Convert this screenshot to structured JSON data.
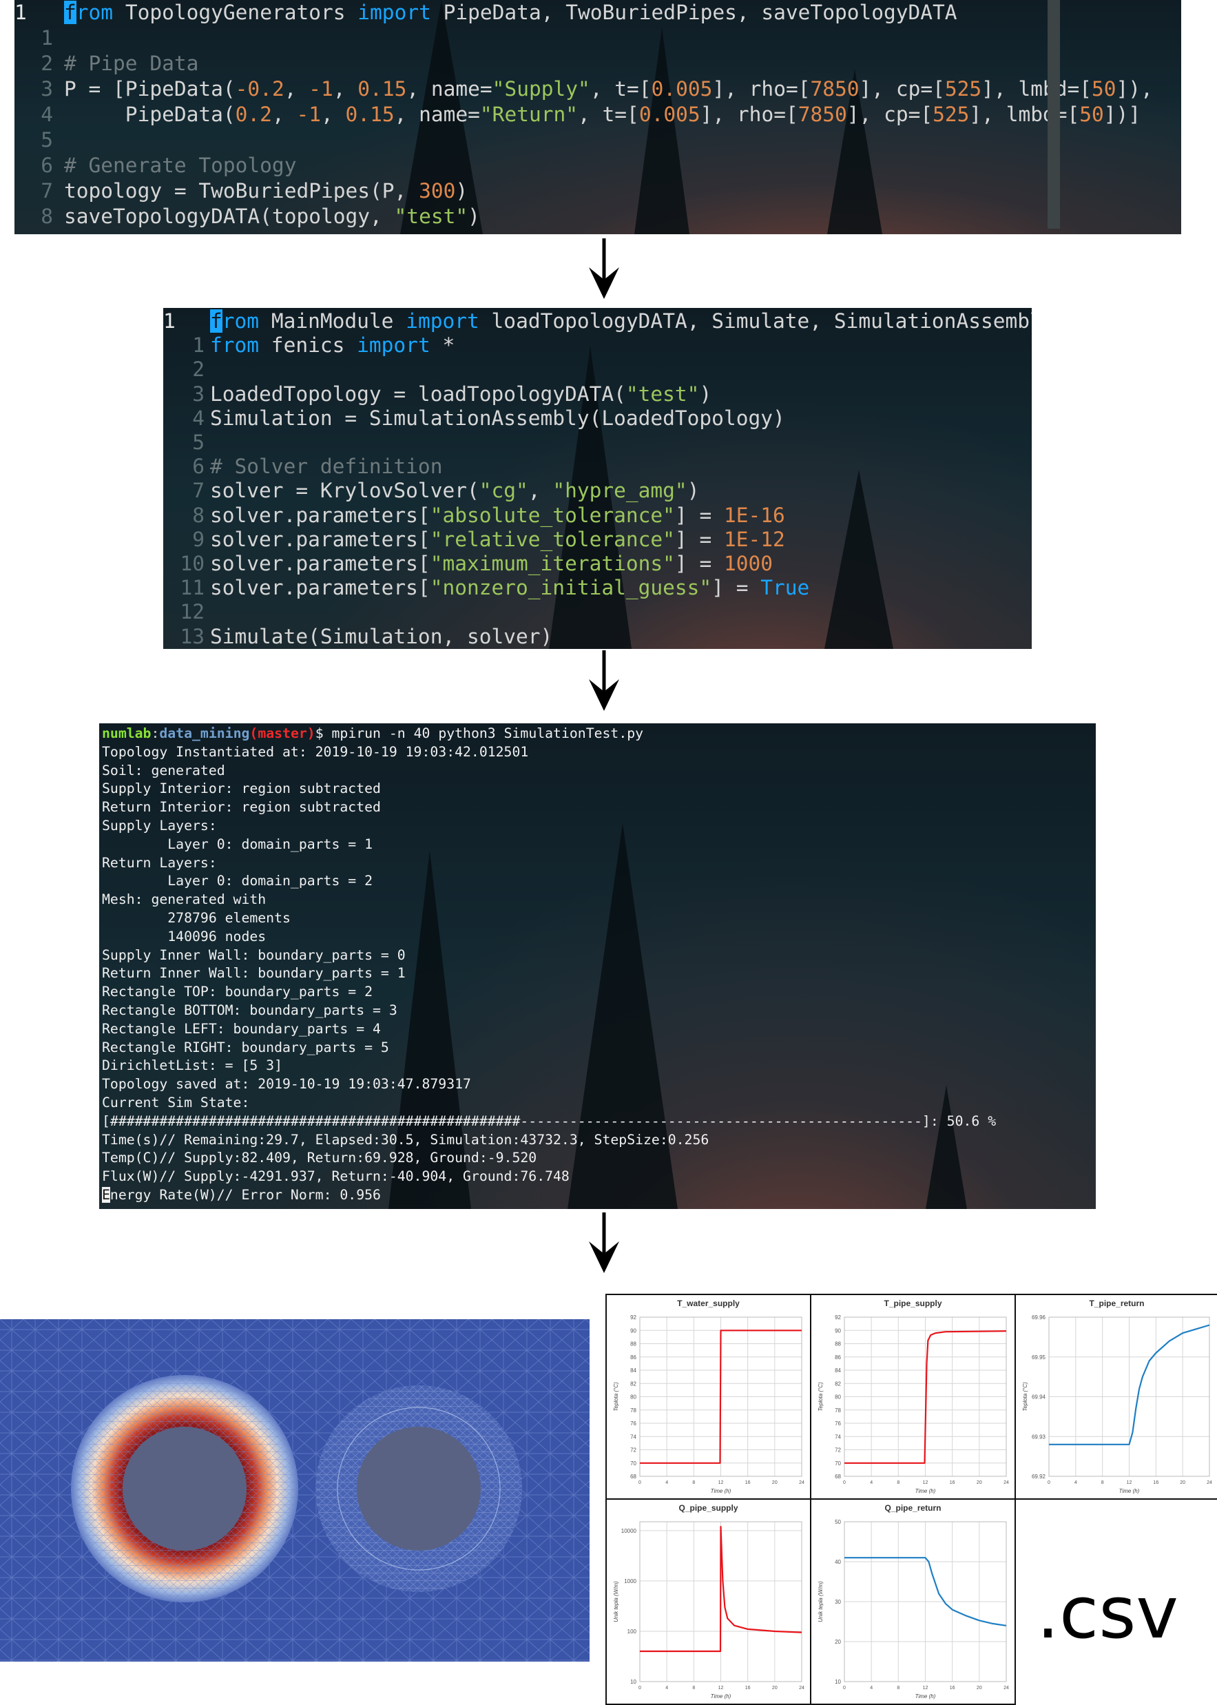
{
  "editor1": {
    "lines": [
      {
        "num": "1",
        "cur": true,
        "parts": [
          [
            "cursor",
            "f"
          ],
          [
            "kw",
            "rom"
          ],
          [
            "t",
            " TopologyGenerators "
          ],
          [
            "kw",
            "import"
          ],
          [
            "t",
            " PipeData, TwoBuriedPipes, saveTopologyDATA"
          ]
        ]
      },
      {
        "num": "1",
        "parts": []
      },
      {
        "num": "2",
        "parts": [
          [
            "cmt",
            "# Pipe Data"
          ]
        ]
      },
      {
        "num": "3",
        "parts": [
          [
            "t",
            "P = [PipeData("
          ],
          [
            "num",
            "-0.2"
          ],
          [
            "t",
            ", "
          ],
          [
            "num",
            "-1"
          ],
          [
            "t",
            ", "
          ],
          [
            "num",
            "0.15"
          ],
          [
            "t",
            ", name="
          ],
          [
            "str",
            "\"Supply\""
          ],
          [
            "t",
            ", t=["
          ],
          [
            "num",
            "0.005"
          ],
          [
            "t",
            "], rho=["
          ],
          [
            "num",
            "7850"
          ],
          [
            "t",
            "], cp=["
          ],
          [
            "num",
            "525"
          ],
          [
            "t",
            "], lmbd=["
          ],
          [
            "num",
            "50"
          ],
          [
            "t",
            "]),"
          ]
        ]
      },
      {
        "num": "4",
        "parts": [
          [
            "t",
            "     PipeData("
          ],
          [
            "num",
            "0.2"
          ],
          [
            "t",
            ", "
          ],
          [
            "num",
            "-1"
          ],
          [
            "t",
            ", "
          ],
          [
            "num",
            "0.15"
          ],
          [
            "t",
            ", name="
          ],
          [
            "str",
            "\"Return\""
          ],
          [
            "t",
            ", t=["
          ],
          [
            "num",
            "0.005"
          ],
          [
            "t",
            "], rho=["
          ],
          [
            "num",
            "7850"
          ],
          [
            "t",
            "], cp=["
          ],
          [
            "num",
            "525"
          ],
          [
            "t",
            "], lmbd=["
          ],
          [
            "num",
            "50"
          ],
          [
            "t",
            "])]"
          ]
        ]
      },
      {
        "num": "5",
        "parts": []
      },
      {
        "num": "6",
        "parts": [
          [
            "cmt",
            "# Generate Topology"
          ]
        ]
      },
      {
        "num": "7",
        "parts": [
          [
            "t",
            "topology = TwoBuriedPipes(P, "
          ],
          [
            "num",
            "300"
          ],
          [
            "t",
            ")"
          ]
        ]
      },
      {
        "num": "8",
        "parts": [
          [
            "t",
            "saveTopologyDATA(topology, "
          ],
          [
            "str",
            "\"test\""
          ],
          [
            "t",
            ")"
          ]
        ]
      }
    ]
  },
  "editor2": {
    "lines": [
      {
        "num": "1",
        "cur": true,
        "parts": [
          [
            "cursor",
            "f"
          ],
          [
            "kw",
            "rom"
          ],
          [
            "t",
            " MainModule "
          ],
          [
            "kw",
            "import"
          ],
          [
            "t",
            " loadTopologyDATA, Simulate, SimulationAssembly"
          ]
        ]
      },
      {
        "num": "1",
        "parts": [
          [
            "kw",
            "from"
          ],
          [
            "t",
            " fenics "
          ],
          [
            "kw",
            "import"
          ],
          [
            "t",
            " *"
          ]
        ]
      },
      {
        "num": "2",
        "parts": []
      },
      {
        "num": "3",
        "parts": [
          [
            "t",
            "LoadedTopology = loadTopologyDATA("
          ],
          [
            "str",
            "\"test\""
          ],
          [
            "t",
            ")"
          ]
        ]
      },
      {
        "num": "4",
        "parts": [
          [
            "t",
            "Simulation = SimulationAssembly(LoadedTopology)"
          ]
        ]
      },
      {
        "num": "5",
        "parts": []
      },
      {
        "num": "6",
        "parts": [
          [
            "cmt",
            "# Solver definition"
          ]
        ]
      },
      {
        "num": "7",
        "parts": [
          [
            "t",
            "solver = KrylovSolver("
          ],
          [
            "str",
            "\"cg\""
          ],
          [
            "t",
            ", "
          ],
          [
            "str",
            "\"hypre_amg\""
          ],
          [
            "t",
            ")"
          ]
        ]
      },
      {
        "num": "8",
        "parts": [
          [
            "t",
            "solver.parameters["
          ],
          [
            "str",
            "\"absolute_tolerance\""
          ],
          [
            "t",
            "] = "
          ],
          [
            "num",
            "1E-16"
          ]
        ]
      },
      {
        "num": "9",
        "parts": [
          [
            "t",
            "solver.parameters["
          ],
          [
            "str",
            "\"relative_tolerance\""
          ],
          [
            "t",
            "] = "
          ],
          [
            "num",
            "1E-12"
          ]
        ]
      },
      {
        "num": "10",
        "parts": [
          [
            "t",
            "solver.parameters["
          ],
          [
            "str",
            "\"maximum_iterations\""
          ],
          [
            "t",
            "] = "
          ],
          [
            "num",
            "1000"
          ]
        ]
      },
      {
        "num": "11",
        "parts": [
          [
            "t",
            "solver.parameters["
          ],
          [
            "str",
            "\"nonzero_initial_guess\""
          ],
          [
            "t",
            "] = "
          ],
          [
            "kw",
            "True"
          ]
        ]
      },
      {
        "num": "12",
        "parts": []
      },
      {
        "num": "13",
        "parts": [
          [
            "t",
            "Simulate(Simulation, solver)"
          ]
        ]
      }
    ]
  },
  "terminal": {
    "user": "numlab",
    "colon": ":",
    "path": "data_mining",
    "branch": "(master)",
    "command": "$ mpirun -n 40 python3 SimulationTest.py",
    "lines": [
      "Topology Instantiated at: 2019-10-19 19:03:42.012501",
      "Soil: generated",
      "Supply Interior: region subtracted",
      "Return Interior: region subtracted",
      "Supply Layers:",
      "        Layer 0: domain_parts = 1",
      "Return Layers:",
      "        Layer 0: domain_parts = 2",
      "Mesh: generated with",
      "        278796 elements",
      "        140096 nodes",
      "Supply Inner Wall: boundary_parts = 0",
      "Return Inner Wall: boundary_parts = 1",
      "Rectangle TOP: boundary_parts = 2",
      "Rectangle BOTTOM: boundary_parts = 3",
      "Rectangle LEFT: boundary_parts = 4",
      "Rectangle RIGHT: boundary_parts = 5",
      "DirichletList: = [5 3]",
      "Topology saved at: 2019-10-19 19:03:47.879317",
      "Current Sim State:",
      "[##################################################-------------------------------------------------]: 50.6 %",
      "Time(s)// Remaining:29.7, Elapsed:30.5, Simulation:43732.3, StepSize:0.256",
      "Temp(C)// Supply:82.409, Return:69.928, Ground:-9.520",
      "Flux(W)// Supply:-4291.937, Return:-40.904, Ground:76.748"
    ],
    "last_cursor": "E",
    "last_rest": "nergy Rate(W)// Error Norm: 0.956"
  },
  "csv_label": ".csv",
  "colors": {
    "red": "#e8141b",
    "blue": "#1f7fc4",
    "cursor": "#18a6ff"
  },
  "chart_data": [
    {
      "type": "line",
      "title": "T_water_supply",
      "xlabel": "Time (h)",
      "ylabel": "Teplota (°C)",
      "xlim": [
        0,
        24
      ],
      "ylim": [
        68,
        92
      ],
      "x_ticks": [
        0,
        4,
        8,
        12,
        16,
        20,
        24
      ],
      "y_ticks": [
        68,
        70,
        72,
        74,
        76,
        78,
        80,
        82,
        84,
        86,
        88,
        90,
        92
      ],
      "color": "red",
      "scale": "linear",
      "series": [
        {
          "x": [
            0,
            11.9,
            11.95,
            12,
            24
          ],
          "y": [
            70,
            70,
            80,
            90,
            90
          ]
        }
      ]
    },
    {
      "type": "line",
      "title": "T_pipe_supply",
      "xlabel": "Time (h)",
      "ylabel": "Teplota (°C)",
      "xlim": [
        0,
        24
      ],
      "ylim": [
        68,
        92
      ],
      "x_ticks": [
        0,
        4,
        8,
        12,
        16,
        20,
        24
      ],
      "y_ticks": [
        68,
        70,
        72,
        74,
        76,
        78,
        80,
        82,
        84,
        86,
        88,
        90,
        92
      ],
      "color": "red",
      "scale": "linear",
      "series": [
        {
          "x": [
            0,
            11.9,
            12,
            12.2,
            12.4,
            12.8,
            13.5,
            15,
            24
          ],
          "y": [
            70,
            70,
            75,
            85,
            88.5,
            89.3,
            89.6,
            89.8,
            89.9
          ]
        }
      ]
    },
    {
      "type": "line",
      "title": "T_pipe_return",
      "xlabel": "Time (h)",
      "ylabel": "Teplota (°C)",
      "xlim": [
        0,
        24
      ],
      "ylim": [
        69.92,
        69.96
      ],
      "x_ticks": [
        0,
        4,
        8,
        12,
        16,
        20,
        24
      ],
      "y_ticks": [
        69.92,
        69.93,
        69.94,
        69.95,
        69.96
      ],
      "color": "blue",
      "scale": "linear",
      "series": [
        {
          "x": [
            0,
            12,
            12.5,
            13,
            13.5,
            14,
            15,
            16,
            18,
            20,
            22,
            24
          ],
          "y": [
            69.928,
            69.928,
            69.931,
            69.937,
            69.942,
            69.945,
            69.949,
            69.951,
            69.954,
            69.956,
            69.957,
            69.958
          ]
        }
      ]
    },
    {
      "type": "line",
      "title": "Q_pipe_supply",
      "xlabel": "Time (h)",
      "ylabel": "Unik tepla (W/m)",
      "xlim": [
        0,
        24
      ],
      "ylim": [
        10,
        15000
      ],
      "x_ticks": [
        0,
        4,
        8,
        12,
        16,
        20,
        24
      ],
      "y_ticks": [
        10,
        100,
        1000,
        10000
      ],
      "color": "red",
      "scale": "log",
      "series": [
        {
          "x": [
            0,
            11.95,
            12,
            12.1,
            12.3,
            12.6,
            13,
            14,
            16,
            20,
            24
          ],
          "y": [
            40,
            40,
            12000,
            5000,
            1000,
            300,
            180,
            130,
            110,
            100,
            95
          ]
        }
      ]
    },
    {
      "type": "line",
      "title": "Q_pipe_return",
      "xlabel": "Time (h)",
      "ylabel": "Unik tepla (W/m)",
      "xlim": [
        0,
        24
      ],
      "ylim": [
        10,
        50
      ],
      "x_ticks": [
        0,
        4,
        8,
        12,
        16,
        20,
        24
      ],
      "y_ticks": [
        10,
        20,
        30,
        40,
        50
      ],
      "color": "blue",
      "scale": "linear",
      "series": [
        {
          "x": [
            0,
            12,
            12.5,
            13,
            14,
            15,
            16,
            18,
            20,
            22,
            24
          ],
          "y": [
            41,
            41,
            40,
            37,
            32,
            29.5,
            28,
            26.5,
            25.3,
            24.5,
            24
          ]
        }
      ]
    }
  ]
}
